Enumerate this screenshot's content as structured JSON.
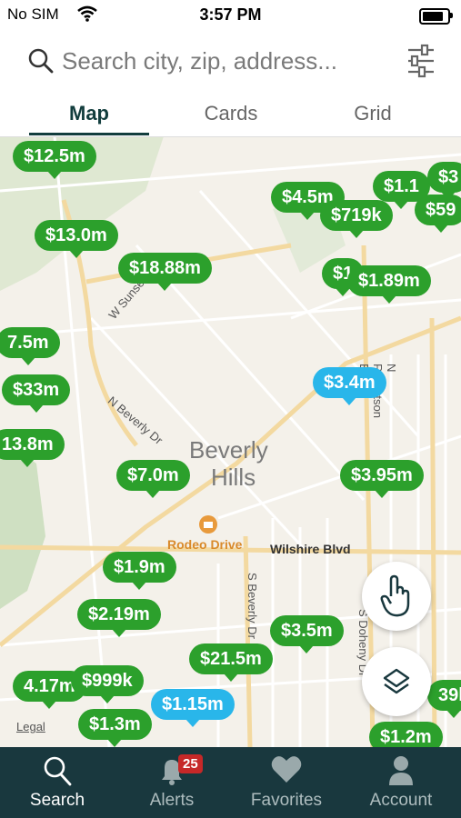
{
  "status_bar": {
    "carrier": "No SIM",
    "time": "3:57 PM"
  },
  "search": {
    "placeholder": "Search city, zip, address..."
  },
  "tabs": [
    {
      "label": "Map",
      "active": true
    },
    {
      "label": "Cards",
      "active": false
    },
    {
      "label": "Grid",
      "active": false
    }
  ],
  "map": {
    "city_label_1": "Beverly",
    "city_label_2": "Hills",
    "streets": {
      "wilshire": "Wilshire Blvd",
      "n_beverly": "N Beverly Dr",
      "s_beverly": "S Beverly Dr",
      "w_sunset": "W Sunset",
      "n_robertson": "N Robertson Blvd",
      "s_doheny": "S Doheny Dr"
    },
    "poi": "Rodeo Drive",
    "legal": "Legal",
    "pins": [
      {
        "price": "$12.5m",
        "type": "green"
      },
      {
        "price": "$13.0m",
        "type": "green"
      },
      {
        "price": "$18.88m",
        "type": "green"
      },
      {
        "price": "$4.5m",
        "type": "green"
      },
      {
        "price": "$719k",
        "type": "green"
      },
      {
        "price": "$1.1",
        "type": "green"
      },
      {
        "price": "$3",
        "type": "green"
      },
      {
        "price": "$59",
        "type": "green"
      },
      {
        "price": "$1.89m",
        "type": "green"
      },
      {
        "price": "$1",
        "type": "green"
      },
      {
        "price": "7.5m",
        "type": "green"
      },
      {
        "price": "$33m",
        "type": "green"
      },
      {
        "price": "$3.4m",
        "type": "blue"
      },
      {
        "price": "13.8m",
        "type": "green"
      },
      {
        "price": "$7.0m",
        "type": "green"
      },
      {
        "price": "$3.95m",
        "type": "green"
      },
      {
        "price": "$1.9m",
        "type": "green"
      },
      {
        "price": "$2.19m",
        "type": "green"
      },
      {
        "price": "$3.5m",
        "type": "green"
      },
      {
        "price": "$21.5m",
        "type": "green"
      },
      {
        "price": "4.17m",
        "type": "green"
      },
      {
        "price": "$999k",
        "type": "green"
      },
      {
        "price": "$1.15m",
        "type": "blue"
      },
      {
        "price": "$1.3m",
        "type": "green"
      },
      {
        "price": "$1.2m",
        "type": "green"
      },
      {
        "price": "39k",
        "type": "green"
      }
    ]
  },
  "bottom_nav": [
    {
      "label": "Search",
      "icon": "search-icon",
      "active": true
    },
    {
      "label": "Alerts",
      "icon": "bell-icon",
      "badge": "25"
    },
    {
      "label": "Favorites",
      "icon": "heart-icon"
    },
    {
      "label": "Account",
      "icon": "person-icon"
    }
  ],
  "colors": {
    "pin_green": "#2ca02c",
    "pin_blue": "#29b6ea",
    "nav_bg": "#19383e",
    "tab_active": "#123d3d"
  }
}
